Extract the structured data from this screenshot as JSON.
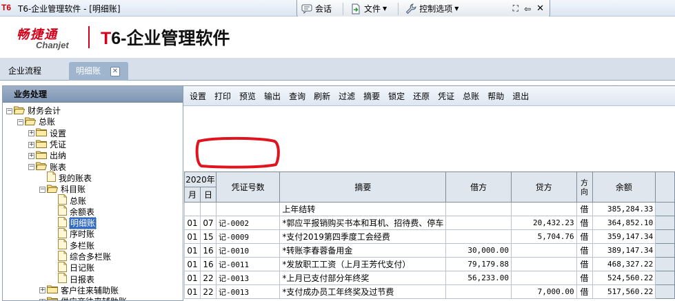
{
  "titlebar": {
    "logo": "T6",
    "title": "T6-企业管理软件 - [明细账]"
  },
  "float_toolbar": {
    "chat": "会话",
    "file": "文件",
    "control": "控制选项"
  },
  "brand": {
    "cn": "畅捷通",
    "en": "Chanjet",
    "product_prefix": "T",
    "product_rest": "6-企业管理软件"
  },
  "tabs": [
    {
      "label": "企业流程"
    },
    {
      "label": "明细账"
    }
  ],
  "left_panel": {
    "header": "业务处理",
    "tree": [
      {
        "label": "财务会计",
        "level": 0,
        "pm": "-",
        "icon": "folder-open"
      },
      {
        "label": "总账",
        "level": 1,
        "pm": "-",
        "icon": "folder-open"
      },
      {
        "label": "设置",
        "level": 2,
        "pm": "+",
        "icon": "folder"
      },
      {
        "label": "凭证",
        "level": 2,
        "pm": "+",
        "icon": "folder"
      },
      {
        "label": "出纳",
        "level": 2,
        "pm": "+",
        "icon": "folder"
      },
      {
        "label": "账表",
        "level": 2,
        "pm": "-",
        "icon": "folder-open"
      },
      {
        "label": "我的账表",
        "level": 3,
        "pm": "",
        "icon": "doc"
      },
      {
        "label": "科目账",
        "level": 3,
        "pm": "-",
        "icon": "folder-open"
      },
      {
        "label": "总账",
        "level": 4,
        "pm": "",
        "icon": "doc"
      },
      {
        "label": "余额表",
        "level": 4,
        "pm": "",
        "icon": "doc"
      },
      {
        "label": "明细账",
        "level": 4,
        "pm": "",
        "icon": "doc",
        "selected": true
      },
      {
        "label": "序时账",
        "level": 4,
        "pm": "",
        "icon": "doc"
      },
      {
        "label": "多栏账",
        "level": 4,
        "pm": "",
        "icon": "doc"
      },
      {
        "label": "综合多栏账",
        "level": 4,
        "pm": "",
        "icon": "doc"
      },
      {
        "label": "日记账",
        "level": 4,
        "pm": "",
        "icon": "doc"
      },
      {
        "label": "日报表",
        "level": 4,
        "pm": "",
        "icon": "doc"
      },
      {
        "label": "客户往来辅助账",
        "level": 3,
        "pm": "+",
        "icon": "folder"
      },
      {
        "label": "供应商往来辅助账",
        "level": 3,
        "pm": "+",
        "icon": "folder"
      }
    ]
  },
  "toolbar": [
    "设置",
    "打印",
    "预览",
    "输出",
    "查询",
    "刷新",
    "过滤",
    "摘要",
    "锁定",
    "还原",
    "凭证",
    "总账",
    "帮助",
    "退出"
  ],
  "table": {
    "year": "2020年",
    "month": "月",
    "day": "日",
    "voucher": "凭证号数",
    "summary": "摘要",
    "debit": "借方",
    "credit": "贷方",
    "direction": "方向",
    "balance": "余额",
    "rows": [
      {
        "m": "",
        "d": "",
        "voucher": "",
        "summary": "上年结转",
        "debit": "",
        "credit": "",
        "dir": "借",
        "balance": "385,284.33"
      },
      {
        "m": "01",
        "d": "07",
        "voucher": "记-0002",
        "summary": "*郭应平报销购买书本和耳机、招待费、停车",
        "debit": "",
        "credit": "20,432.23",
        "dir": "借",
        "balance": "364,852.10"
      },
      {
        "m": "01",
        "d": "15",
        "voucher": "记-0009",
        "summary": "*支付2019第四季度工会经费",
        "debit": "",
        "credit": "5,704.76",
        "dir": "借",
        "balance": "359,147.34"
      },
      {
        "m": "01",
        "d": "16",
        "voucher": "记-0010",
        "summary": "*转账李春蓉备用金",
        "debit": "30,000.00",
        "credit": "",
        "dir": "借",
        "balance": "389,147.34"
      },
      {
        "m": "01",
        "d": "16",
        "voucher": "记-0011",
        "summary": "*发放职工工资（上月王芳代支付）",
        "debit": "79,179.88",
        "credit": "",
        "dir": "借",
        "balance": "468,327.22"
      },
      {
        "m": "01",
        "d": "22",
        "voucher": "记-0013",
        "summary": "*上月已支付部分年终奖",
        "debit": "56,233.00",
        "credit": "",
        "dir": "借",
        "balance": "524,560.22"
      },
      {
        "m": "01",
        "d": "22",
        "voucher": "记-0013",
        "summary": "*支付成办员工年终奖及过节费",
        "debit": "",
        "credit": "7,000.00",
        "dir": "借",
        "balance": "517,560.22"
      }
    ]
  },
  "colors": {
    "accent_red": "#d4001a",
    "selection": "#316ac5",
    "annotation": "#e0141e"
  }
}
